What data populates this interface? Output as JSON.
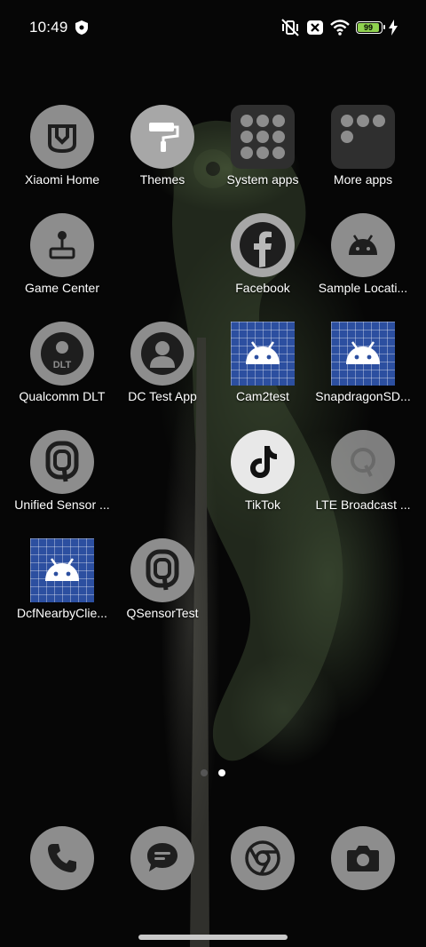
{
  "status_bar": {
    "time": "10:49",
    "battery_level": "99",
    "icons": [
      "shield-icon",
      "vibrate-off-icon",
      "notification-x-icon",
      "wifi-icon",
      "battery-icon",
      "charging-bolt-icon"
    ]
  },
  "apps": [
    {
      "label": "Xiaomi Home",
      "icon": "xiaomi-home-icon"
    },
    {
      "label": "Themes",
      "icon": "paint-roller-icon"
    },
    {
      "label": "System apps",
      "icon": "folder-icon"
    },
    {
      "label": "More apps",
      "icon": "folder-icon"
    },
    {
      "label": "Game Center",
      "icon": "joystick-icon"
    },
    {
      "label": "Facebook",
      "icon": "facebook-icon"
    },
    {
      "label": "Sample Locati...",
      "icon": "android-icon"
    },
    {
      "label": "Qualcomm DLT",
      "icon": "dlt-icon"
    },
    {
      "label": "DC Test App",
      "icon": "person-icon"
    },
    {
      "label": "Cam2test",
      "icon": "android-icon"
    },
    {
      "label": "SnapdragonSD...",
      "icon": "android-icon"
    },
    {
      "label": "Unified Sensor ...",
      "icon": "qualcomm-q-icon"
    },
    {
      "label": "TikTok",
      "icon": "tiktok-icon"
    },
    {
      "label": "LTE Broadcast ...",
      "icon": "qualcomm-q-icon"
    },
    {
      "label": "DcfNearbyClie...",
      "icon": "android-icon"
    },
    {
      "label": "QSensorTest",
      "icon": "qualcomm-q-icon"
    }
  ],
  "dock": [
    {
      "name": "Phone",
      "icon": "phone-icon"
    },
    {
      "name": "Messages",
      "icon": "message-icon"
    },
    {
      "name": "Chrome",
      "icon": "chrome-icon"
    },
    {
      "name": "Camera",
      "icon": "camera-icon"
    }
  ],
  "page_indicator": {
    "pages": 2,
    "current": 2
  },
  "colors": {
    "icon_gray": "#8d8d8d",
    "grid_blue": "#2c4fa0",
    "battery_green": "#8fd14f"
  }
}
